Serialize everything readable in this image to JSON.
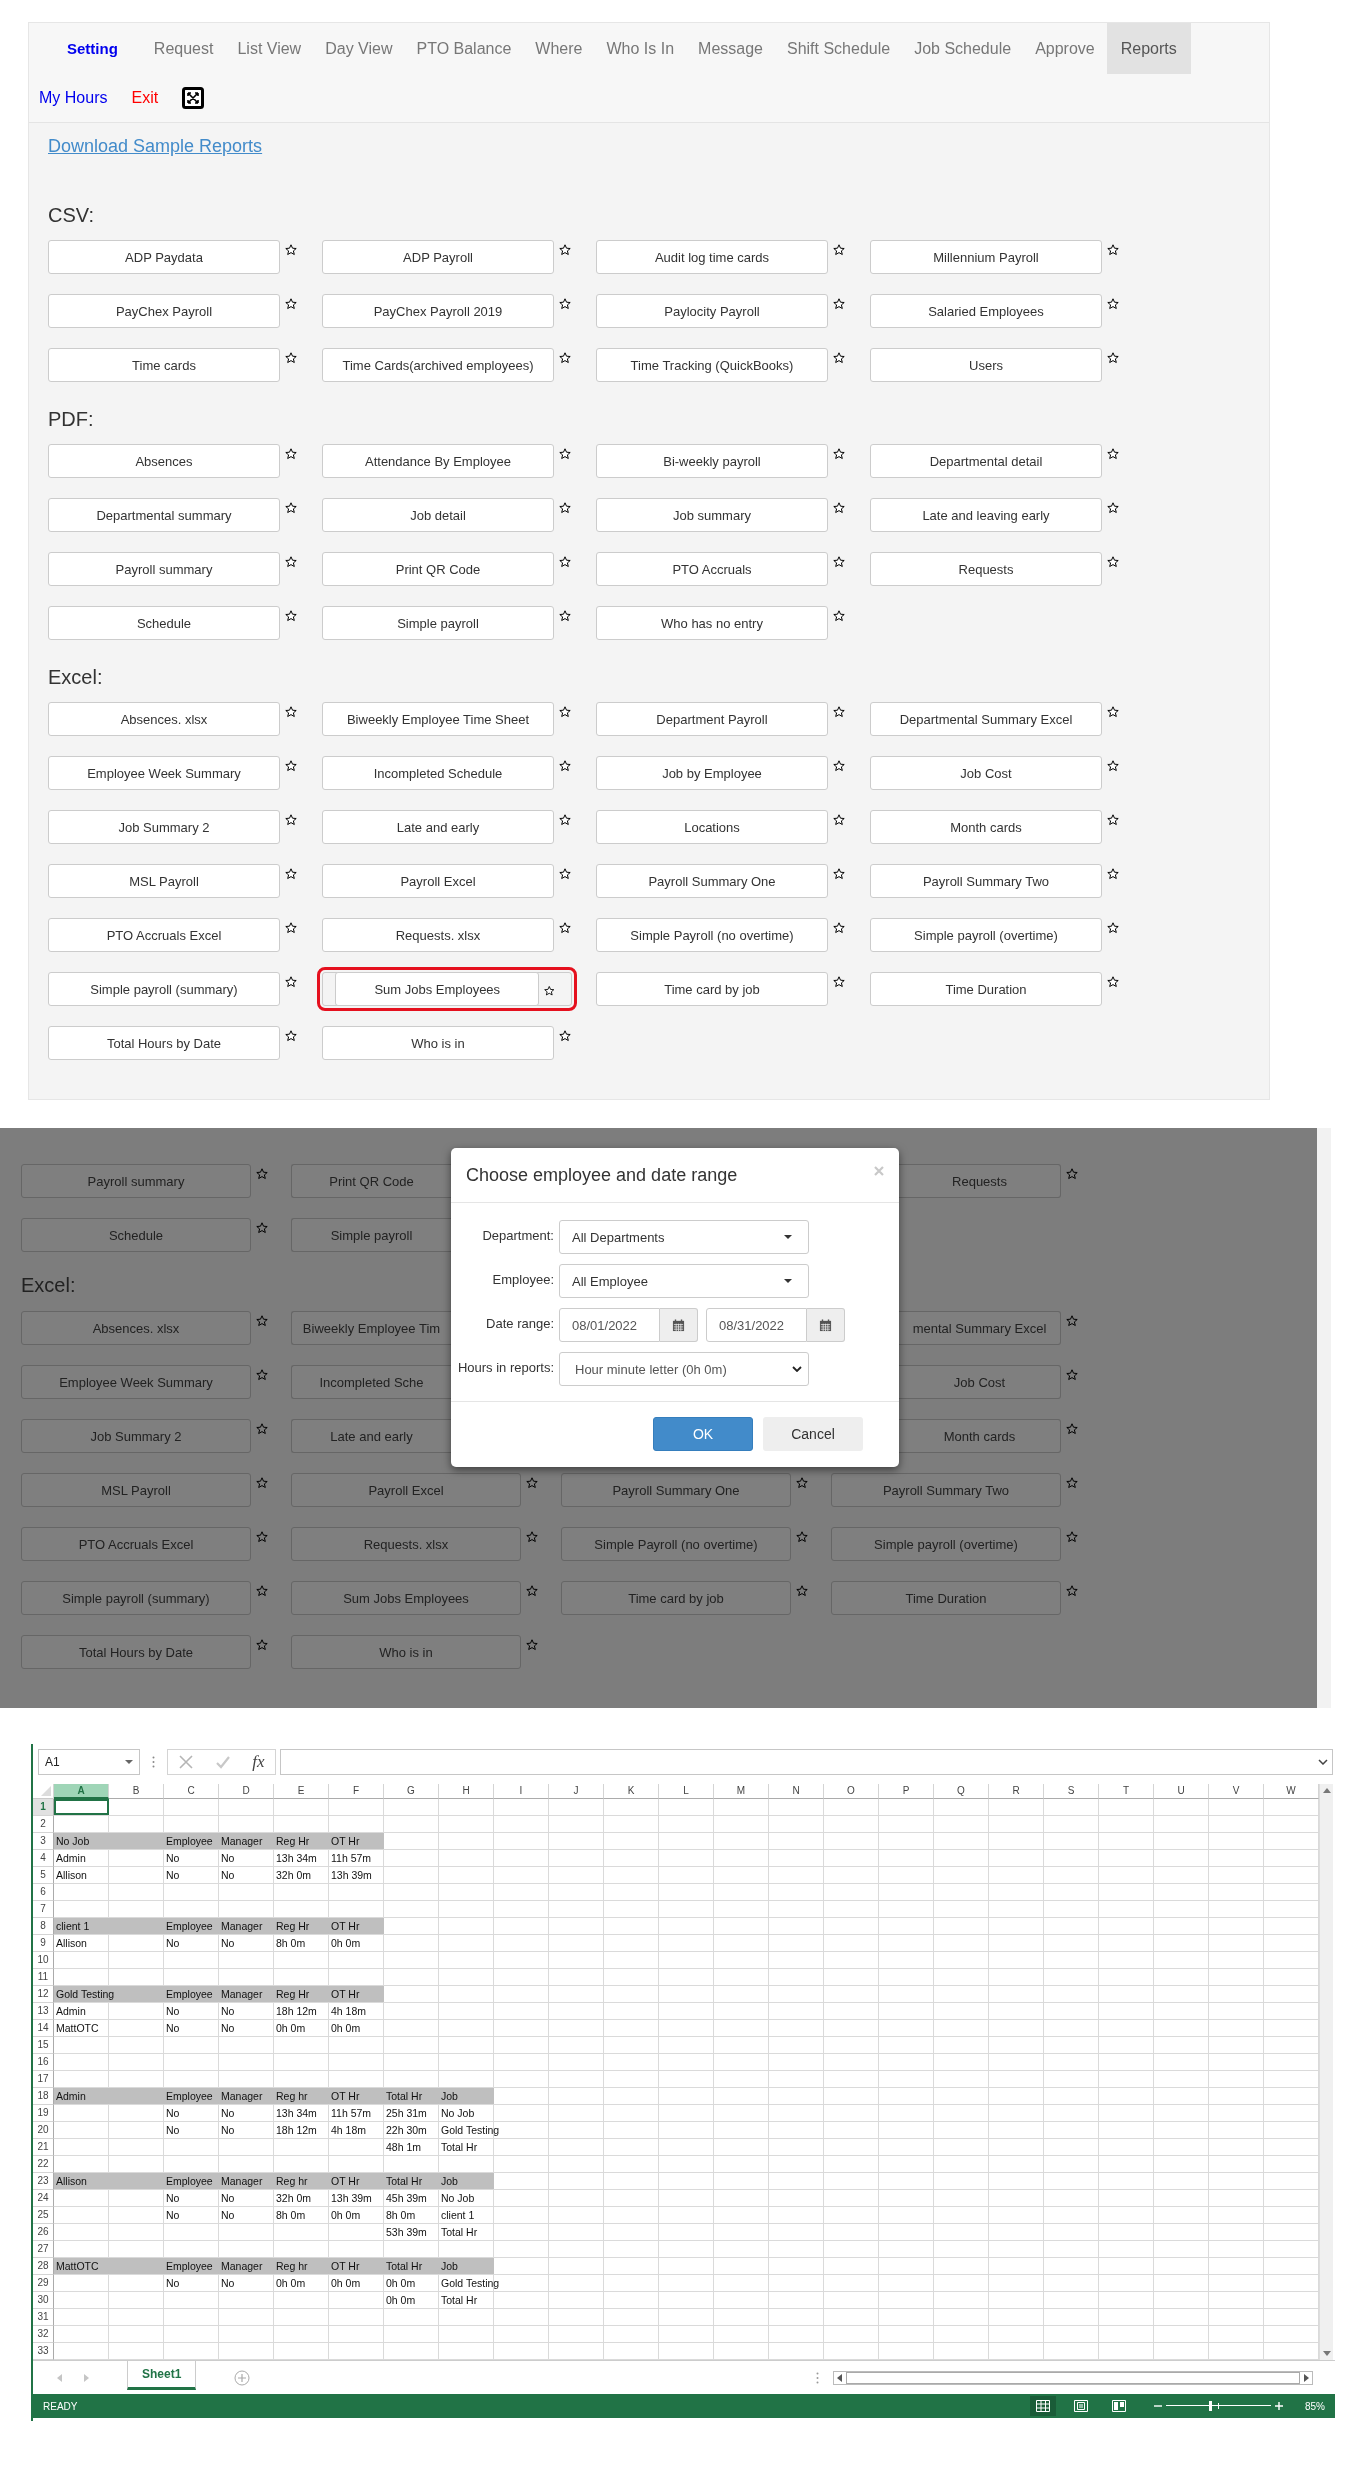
{
  "report_page": {
    "nav_tabs": [
      {
        "label": "Setting",
        "kind": "brand",
        "selected": false
      },
      {
        "label": "Request",
        "kind": "tab",
        "selected": false
      },
      {
        "label": "List View",
        "kind": "tab",
        "selected": false
      },
      {
        "label": "Day View",
        "kind": "tab",
        "selected": false
      },
      {
        "label": "PTO Balance",
        "kind": "tab",
        "selected": false
      },
      {
        "label": "Where",
        "kind": "tab",
        "selected": false
      },
      {
        "label": "Who Is In",
        "kind": "tab",
        "selected": false
      },
      {
        "label": "Message",
        "kind": "tab",
        "selected": false
      },
      {
        "label": "Shift Schedule",
        "kind": "tab",
        "selected": false
      },
      {
        "label": "Job Schedule",
        "kind": "tab",
        "selected": false
      },
      {
        "label": "Approve",
        "kind": "tab",
        "selected": false
      },
      {
        "label": "Reports",
        "kind": "tab",
        "selected": true
      }
    ],
    "user_links": [
      {
        "label": "My Hours",
        "kind": "primary"
      },
      {
        "label": "Exit",
        "kind": "danger"
      }
    ],
    "download_link": "Download Sample Reports",
    "groups": [
      {
        "heading": "CSV:",
        "reports": [
          {
            "label": "ADP Paydata"
          },
          {
            "label": "ADP Payroll"
          },
          {
            "label": "Audit log time cards"
          },
          {
            "label": "Millennium Payroll"
          },
          {
            "label": "PayChex Payroll"
          },
          {
            "label": "PayChex Payroll 2019"
          },
          {
            "label": "Paylocity Payroll"
          },
          {
            "label": "Salaried Employees"
          },
          {
            "label": "Time cards"
          },
          {
            "label": "Time Cards(archived employees)"
          },
          {
            "label": "Time Tracking (QuickBooks)"
          },
          {
            "label": "Users"
          }
        ]
      },
      {
        "heading": "PDF:",
        "reports": [
          {
            "label": "Absences"
          },
          {
            "label": "Attendance By Employee"
          },
          {
            "label": "Bi-weekly payroll"
          },
          {
            "label": "Departmental detail"
          },
          {
            "label": "Departmental summary"
          },
          {
            "label": "Job detail"
          },
          {
            "label": "Job summary"
          },
          {
            "label": "Late and leaving early"
          },
          {
            "label": "Payroll summary"
          },
          {
            "label": "Print QR Code"
          },
          {
            "label": "PTO Accruals"
          },
          {
            "label": "Requests"
          },
          {
            "label": "Schedule"
          },
          {
            "label": "Simple payroll"
          },
          {
            "label": "Who has no entry"
          }
        ]
      },
      {
        "heading": "Excel:",
        "reports": [
          {
            "label": "Absences. xlsx",
            "selected": false
          },
          {
            "label": "Biweekly Employee Time Sheet",
            "selected": false
          },
          {
            "label": "Department Payroll",
            "selected": false
          },
          {
            "label": "Departmental Summary Excel",
            "selected": false
          },
          {
            "label": "Employee Week Summary",
            "selected": false
          },
          {
            "label": "Incompleted Schedule",
            "selected": false
          },
          {
            "label": "Job by Employee",
            "selected": false
          },
          {
            "label": "Job Cost",
            "selected": false
          },
          {
            "label": "Job Summary 2",
            "selected": false
          },
          {
            "label": "Late and early",
            "selected": false
          },
          {
            "label": "Locations",
            "selected": false
          },
          {
            "label": "Month cards",
            "selected": false
          },
          {
            "label": "MSL Payroll",
            "selected": false
          },
          {
            "label": "Payroll Excel",
            "selected": false
          },
          {
            "label": "Payroll Summary One",
            "selected": false
          },
          {
            "label": "Payroll Summary Two",
            "selected": false
          },
          {
            "label": "PTO Accruals Excel",
            "selected": false
          },
          {
            "label": "Requests. xlsx",
            "selected": false
          },
          {
            "label": "Simple Payroll (no overtime)",
            "selected": false
          },
          {
            "label": "Simple payroll (overtime)",
            "selected": false
          },
          {
            "label": "Simple payroll (summary)",
            "selected": false
          },
          {
            "label": "Sum Jobs Employees",
            "selected": true
          },
          {
            "label": "Time card by job",
            "selected": false
          },
          {
            "label": "Time Duration",
            "selected": false
          },
          {
            "label": "Total Hours by Date",
            "selected": false
          },
          {
            "label": "Who is in",
            "selected": false
          }
        ]
      }
    ]
  },
  "dialog_screen": {
    "background_sections": [
      {
        "rows": [
          [
            {
              "label": "Payroll summary",
              "kind": "full"
            },
            {
              "label": "Print QR Code",
              "kind": "cut-right"
            },
            {
              "kind": "hidden"
            },
            {
              "label": "Requests",
              "kind": "cut-left"
            }
          ],
          [
            {
              "label": "Schedule",
              "kind": "full"
            },
            {
              "label": "Simple payroll",
              "kind": "cut-right"
            },
            {
              "kind": "hidden"
            }
          ]
        ]
      },
      {
        "heading": "Excel:",
        "rows": [
          [
            {
              "label": "Absences. xlsx",
              "kind": "full"
            },
            {
              "label": "Biweekly Employee Tim",
              "kind": "cut-right"
            },
            {
              "kind": "hidden"
            },
            {
              "label": "mental Summary Excel",
              "kind": "cut-left"
            }
          ],
          [
            {
              "label": "Employee Week Summary",
              "kind": "full"
            },
            {
              "label": "Incompleted Sche",
              "kind": "cut-right"
            },
            {
              "kind": "hidden"
            },
            {
              "label": "Job Cost",
              "kind": "cut-left"
            }
          ],
          [
            {
              "label": "Job Summary 2",
              "kind": "full"
            },
            {
              "label": "Late and early",
              "kind": "cut-right"
            },
            {
              "kind": "hidden"
            },
            {
              "label": "Month cards",
              "kind": "cut-left"
            }
          ],
          [
            {
              "label": "MSL Payroll",
              "kind": "full"
            },
            {
              "label": "Payroll Excel",
              "kind": "full"
            },
            {
              "label": "Payroll Summary One",
              "kind": "full"
            },
            {
              "label": "Payroll Summary Two",
              "kind": "full"
            }
          ],
          [
            {
              "label": "PTO Accruals Excel",
              "kind": "full"
            },
            {
              "label": "Requests. xlsx",
              "kind": "full"
            },
            {
              "label": "Simple Payroll (no overtime)",
              "kind": "full"
            },
            {
              "label": "Simple payroll (overtime)",
              "kind": "full"
            }
          ],
          [
            {
              "label": "Simple payroll (summary)",
              "kind": "full"
            },
            {
              "label": "Sum Jobs Employees",
              "kind": "full"
            },
            {
              "label": "Time card by job",
              "kind": "full"
            },
            {
              "label": "Time Duration",
              "kind": "full"
            }
          ],
          [
            {
              "label": "Total Hours by Date",
              "kind": "full"
            },
            {
              "label": "Who is in",
              "kind": "full"
            }
          ]
        ]
      }
    ],
    "dialog": {
      "title": "Choose employee and date range",
      "fields": [
        {
          "label": "Department:",
          "kind": "dropdown",
          "value": "All Departments"
        },
        {
          "label": "Employee:",
          "kind": "dropdown",
          "value": "All Employee"
        },
        {
          "label": "Date range:",
          "kind": "dates",
          "from": "08/01/2022",
          "to": "08/31/2022"
        },
        {
          "label": "Hours in reports:",
          "kind": "select",
          "value": "Hour minute letter (0h 0m)"
        }
      ],
      "buttons": [
        {
          "label": "OK",
          "kind": "primary"
        },
        {
          "label": "Cancel",
          "kind": "default"
        }
      ]
    }
  },
  "spreadsheet": {
    "name_box": "A1",
    "function_label": "fx",
    "columns": [
      {
        "label": "A",
        "selected": true
      },
      {
        "label": "B",
        "selected": false
      },
      {
        "label": "C",
        "selected": false
      },
      {
        "label": "D",
        "selected": false
      },
      {
        "label": "E",
        "selected": false
      },
      {
        "label": "F",
        "selected": false
      },
      {
        "label": "G",
        "selected": false
      },
      {
        "label": "H",
        "selected": false
      },
      {
        "label": "I",
        "selected": false
      },
      {
        "label": "J",
        "selected": false
      },
      {
        "label": "K",
        "selected": false
      },
      {
        "label": "L",
        "selected": false
      },
      {
        "label": "M",
        "selected": false
      },
      {
        "label": "N",
        "selected": false
      },
      {
        "label": "O",
        "selected": false
      },
      {
        "label": "P",
        "selected": false
      },
      {
        "label": "Q",
        "selected": false
      },
      {
        "label": "R",
        "selected": false
      },
      {
        "label": "S",
        "selected": false
      },
      {
        "label": "T",
        "selected": false
      },
      {
        "label": "U",
        "selected": false
      },
      {
        "label": "V",
        "selected": false
      },
      {
        "label": "W",
        "selected": false
      }
    ],
    "rows": [
      {
        "number": "1",
        "selected": true
      },
      {
        "number": "2",
        "selected": false
      },
      {
        "number": "3",
        "selected": false,
        "header": true,
        "cells": [
          "No Job",
          null,
          "Employee",
          "Manager",
          "Reg Hr",
          "OT Hr"
        ]
      },
      {
        "number": "4",
        "selected": false,
        "cells": [
          "Admin",
          null,
          "No",
          "No",
          "13h 34m",
          "11h 57m"
        ]
      },
      {
        "number": "5",
        "selected": false,
        "cells": [
          "Allison",
          null,
          "No",
          "No",
          "32h 0m",
          "13h 39m"
        ]
      },
      {
        "number": "6",
        "selected": false
      },
      {
        "number": "7",
        "selected": false
      },
      {
        "number": "8",
        "selected": false,
        "header": true,
        "cells": [
          "client 1",
          null,
          "Employee",
          "Manager",
          "Reg Hr",
          "OT Hr"
        ]
      },
      {
        "number": "9",
        "selected": false,
        "cells": [
          "Allison",
          null,
          "No",
          "No",
          "8h 0m",
          "0h 0m"
        ]
      },
      {
        "number": "10",
        "selected": false
      },
      {
        "number": "11",
        "selected": false
      },
      {
        "number": "12",
        "selected": false,
        "header": true,
        "cells": [
          "Gold Testing",
          null,
          "Employee",
          "Manager",
          "Reg Hr",
          "OT Hr"
        ]
      },
      {
        "number": "13",
        "selected": false,
        "cells": [
          "Admin",
          null,
          "No",
          "No",
          "18h 12m",
          "4h 18m"
        ]
      },
      {
        "number": "14",
        "selected": false,
        "cells": [
          "MattOTC",
          null,
          "No",
          "No",
          "0h 0m",
          "0h 0m"
        ]
      },
      {
        "number": "15",
        "selected": false
      },
      {
        "number": "16",
        "selected": false
      },
      {
        "number": "17",
        "selected": false
      },
      {
        "number": "18",
        "selected": false,
        "header": true,
        "cells": [
          "Admin",
          null,
          "Employee",
          "Manager",
          "Reg hr",
          "OT Hr",
          "Total Hr",
          "Job"
        ]
      },
      {
        "number": "19",
        "selected": false,
        "cells": [
          null,
          null,
          "No",
          "No",
          "13h 34m",
          "11h 57m",
          "25h 31m",
          "No Job"
        ]
      },
      {
        "number": "20",
        "selected": false,
        "cells": [
          null,
          null,
          "No",
          "No",
          "18h 12m",
          "4h 18m",
          "22h 30m",
          "Gold Testing"
        ]
      },
      {
        "number": "21",
        "selected": false,
        "cells": [
          null,
          null,
          null,
          null,
          null,
          null,
          "48h 1m",
          "Total Hr"
        ]
      },
      {
        "number": "22",
        "selected": false
      },
      {
        "number": "23",
        "selected": false,
        "header": true,
        "cells": [
          "Allison",
          null,
          "Employee",
          "Manager",
          "Reg hr",
          "OT Hr",
          "Total Hr",
          "Job"
        ]
      },
      {
        "number": "24",
        "selected": false,
        "cells": [
          null,
          null,
          "No",
          "No",
          "32h 0m",
          "13h 39m",
          "45h 39m",
          "No Job"
        ]
      },
      {
        "number": "25",
        "selected": false,
        "cells": [
          null,
          null,
          "No",
          "No",
          "8h 0m",
          "0h 0m",
          "8h 0m",
          "client 1"
        ]
      },
      {
        "number": "26",
        "selected": false,
        "cells": [
          null,
          null,
          null,
          null,
          null,
          null,
          "53h 39m",
          "Total Hr"
        ]
      },
      {
        "number": "27",
        "selected": false
      },
      {
        "number": "28",
        "selected": false,
        "header": true,
        "cells": [
          "MattOTC",
          null,
          "Employee",
          "Manager",
          "Reg hr",
          "OT Hr",
          "Total Hr",
          "Job"
        ]
      },
      {
        "number": "29",
        "selected": false,
        "cells": [
          null,
          null,
          "No",
          "No",
          "0h 0m",
          "0h 0m",
          "0h 0m",
          "Gold Testing"
        ]
      },
      {
        "number": "30",
        "selected": false,
        "cells": [
          null,
          null,
          null,
          null,
          null,
          null,
          "0h 0m",
          "Total Hr"
        ]
      },
      {
        "number": "31",
        "selected": false
      },
      {
        "number": "32",
        "selected": false
      },
      {
        "number": "33",
        "selected": false
      }
    ],
    "sheet_tab": "Sheet1",
    "status": "READY",
    "zoom_slider": {
      "level": 0.42
    },
    "zoom_reading": "85%"
  }
}
